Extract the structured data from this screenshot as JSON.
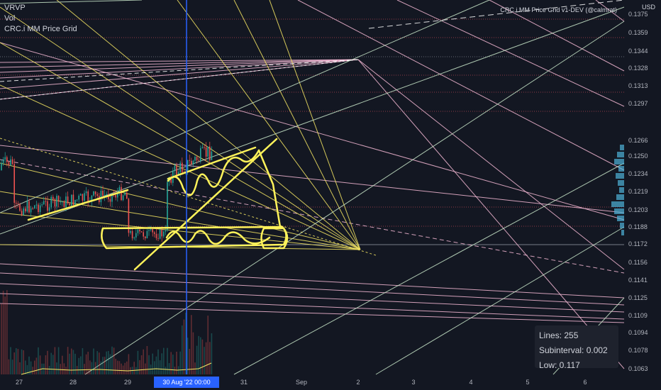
{
  "legend": {
    "vrvp": "VRVP",
    "vol": "Vol",
    "indicator": "CRC.i MM Price Grid"
  },
  "script_title": "CRC.i MM Price Grid v1-DEV (@calmrat)",
  "currency": "USD",
  "price_ticks": [
    "0.1375",
    "0.1359",
    "0.1344",
    "0.1328",
    "0.1313",
    "0.1297",
    "0.1266",
    "0.1250",
    "0.1234",
    "0.1219",
    "0.1203",
    "0.1188",
    "0.1172",
    "0.1156",
    "0.1141",
    "0.1125",
    "0.1109",
    "0.1094",
    "0.1078",
    "0.1063"
  ],
  "time_ticks": [
    "27",
    "28",
    "29",
    "31",
    "Sep",
    "2",
    "3",
    "4",
    "5",
    "6"
  ],
  "crosshair_time": "30 Aug '22   00:00",
  "info_box": {
    "lines": "Lines: 255",
    "subinterval": "Subinterval: 0.002",
    "low": "Low: 0.117"
  },
  "colors": {
    "background": "#131722",
    "pink": "#f4b8d4",
    "yellow": "#f5e663",
    "green": "#c8e6c9",
    "blue": "#2962ff",
    "red_grid": "#e04f5f"
  }
}
